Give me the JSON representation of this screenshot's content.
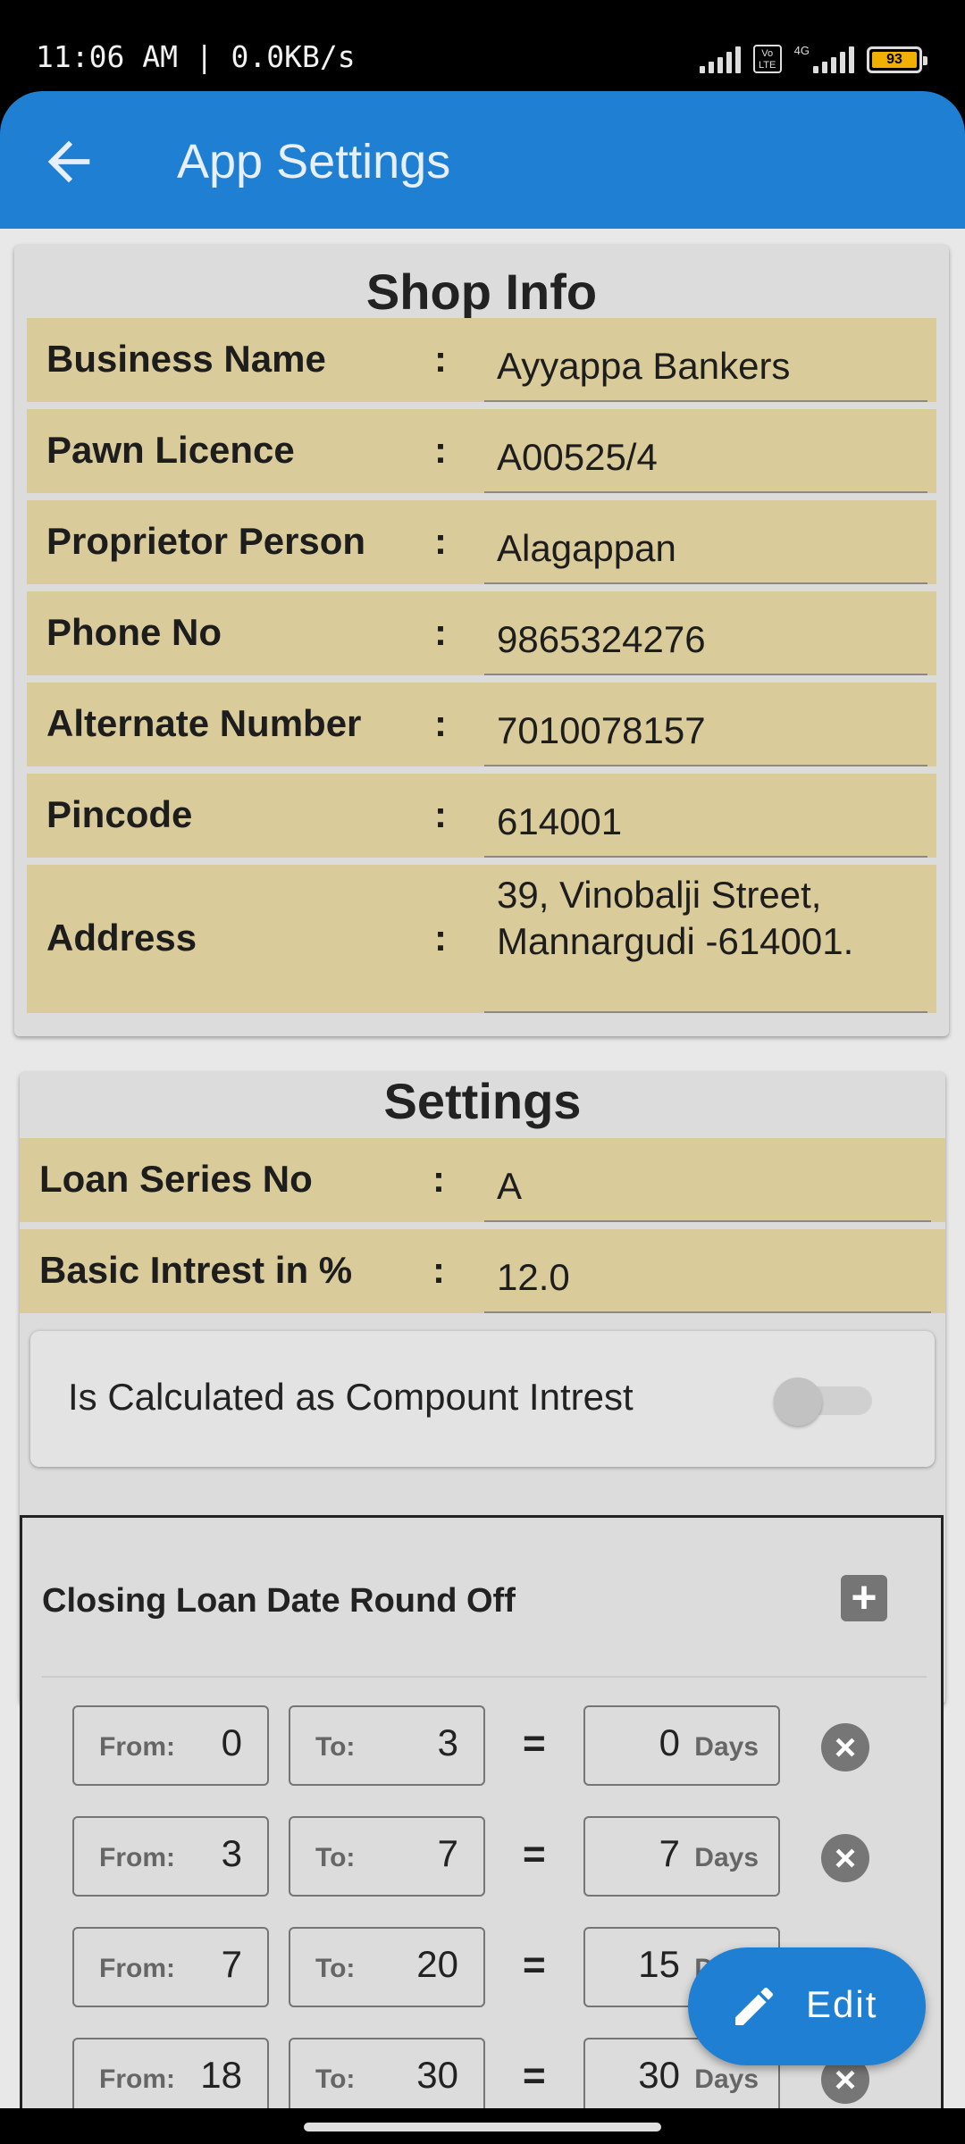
{
  "status_bar": {
    "time": "11:06 AM | 0.0KB/s",
    "volte": "Vo LTE",
    "network": "4G",
    "battery": "93"
  },
  "appbar": {
    "title": "App Settings",
    "back_icon": "arrow-left-icon"
  },
  "shop_info": {
    "title": "Shop Info",
    "rows": [
      {
        "label": "Business Name",
        "colon": ":",
        "value": "Ayyappa Bankers"
      },
      {
        "label": "Pawn Licence",
        "colon": ":",
        "value": "A00525/4"
      },
      {
        "label": "Proprietor Person",
        "colon": ":",
        "value": "Alagappan"
      },
      {
        "label": "Phone No",
        "colon": ":",
        "value": "9865324276"
      },
      {
        "label": "Alternate Number",
        "colon": ":",
        "value": "7010078157"
      },
      {
        "label": "Pincode",
        "colon": ":",
        "value": "614001"
      },
      {
        "label": "Address",
        "colon": ":",
        "value_line1": "39, Vinobalji Street,",
        "value_line2": "Mannargudi -614001."
      }
    ]
  },
  "settings": {
    "title": "Settings",
    "rows": [
      {
        "label": "Loan Series No",
        "colon": ":",
        "value": "A"
      },
      {
        "label": "Basic Intrest in %",
        "colon": ":",
        "value": "12.0"
      }
    ],
    "compound_toggle": {
      "label": "Is Calculated as Compount Intrest",
      "on": false
    }
  },
  "round_off": {
    "title": "Closing Loan Date Round Off",
    "add_icon": "plus-box-icon",
    "remove_icon": "close-circle-icon",
    "from_label": "From:",
    "to_label": "To:",
    "equals": "=",
    "days_label": "Days",
    "rows": [
      {
        "from": "0",
        "to": "3",
        "days": "0"
      },
      {
        "from": "3",
        "to": "7",
        "days": "7"
      },
      {
        "from": "7",
        "to": "20",
        "days": "15"
      },
      {
        "from": "18",
        "to": "30",
        "days": "30"
      }
    ]
  },
  "fab": {
    "label": "Edit",
    "icon": "pencil-icon"
  },
  "colors": {
    "primary": "#1e7fd3",
    "row_bg": "#d9cb9a",
    "card_bg": "#dcdcdc"
  }
}
